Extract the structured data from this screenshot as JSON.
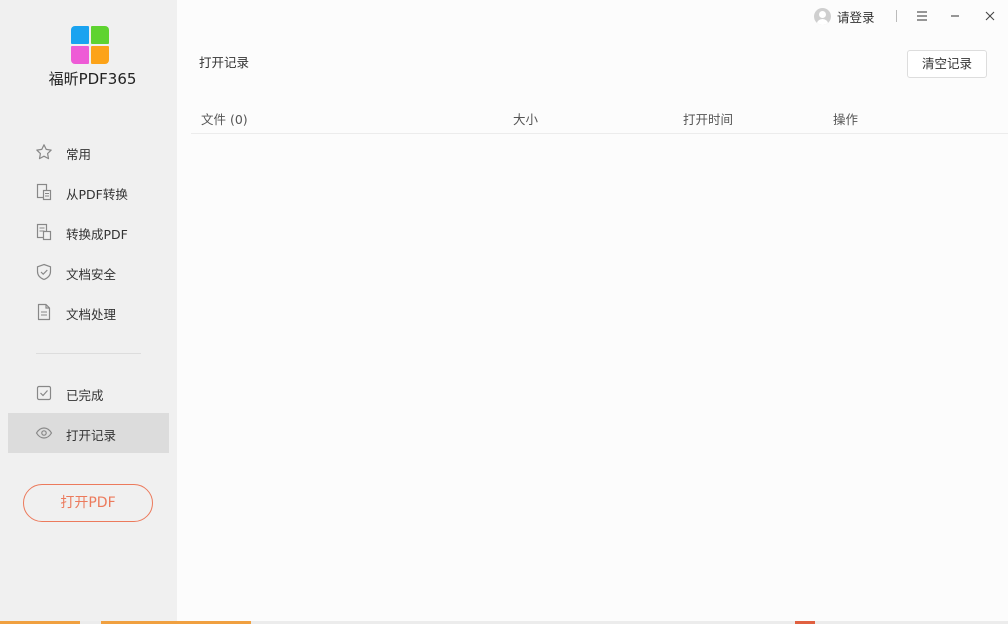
{
  "app": {
    "name": "福昕PDF365"
  },
  "titlebar": {
    "login_label": "请登录",
    "icons": [
      "user-avatar-icon",
      "menu-icon",
      "minimize-icon",
      "close-icon"
    ]
  },
  "sidebar": {
    "items": [
      {
        "label": "常用",
        "icon": "star-icon"
      },
      {
        "label": "从PDF转换",
        "icon": "convert-from-pdf-icon"
      },
      {
        "label": "转换成PDF",
        "icon": "convert-to-pdf-icon"
      },
      {
        "label": "文档安全",
        "icon": "shield-icon"
      },
      {
        "label": "文档处理",
        "icon": "document-icon"
      }
    ],
    "items2": [
      {
        "label": "已完成",
        "icon": "checkbox-icon"
      },
      {
        "label": "打开记录",
        "icon": "eye-icon",
        "active": true
      }
    ],
    "open_button": "打开PDF"
  },
  "main": {
    "title": "打开记录",
    "clear_button": "清空记录",
    "columns": {
      "file": "文件 (0)",
      "size": "大小",
      "time": "打开时间",
      "op": "操作"
    },
    "rows": []
  },
  "colors": {
    "accent": "#ec7a5c",
    "sidebar_bg": "#f0f0f0",
    "active_item_bg": "#dcdcdc",
    "logo_blue": "#1aa3f0",
    "logo_green": "#5ed330",
    "logo_pink": "#ee5bd6",
    "logo_orange": "#fca319"
  }
}
